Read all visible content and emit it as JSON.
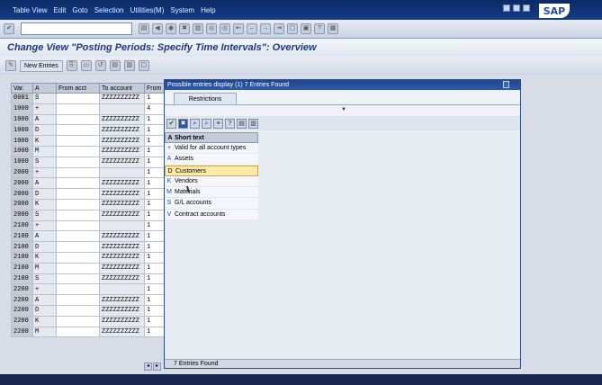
{
  "menu": [
    "Table View",
    "Edit",
    "Goto",
    "Selection",
    "Utilities(M)",
    "System",
    "Help"
  ],
  "brand": "SAP",
  "title": "Change View \"Posting Periods: Specify Time Intervals\": Overview",
  "toolbar2": {
    "new_entries": "New Entries"
  },
  "grid": {
    "headers": [
      "Var.",
      "A",
      "From acct",
      "To account",
      "From"
    ],
    "rows": [
      [
        "0001",
        "S",
        "",
        "ZZZZZZZZZZ",
        "1"
      ],
      [
        "1000",
        "+",
        "",
        "",
        "4"
      ],
      [
        "1000",
        "A",
        "",
        "ZZZZZZZZZZ",
        "1"
      ],
      [
        "1000",
        "D",
        "",
        "ZZZZZZZZZZ",
        "1"
      ],
      [
        "1000",
        "K",
        "",
        "ZZZZZZZZZZ",
        "1"
      ],
      [
        "1000",
        "M",
        "",
        "ZZZZZZZZZZ",
        "1"
      ],
      [
        "1000",
        "S",
        "",
        "ZZZZZZZZZZ",
        "1"
      ],
      [
        "2000",
        "+",
        "",
        "",
        "1"
      ],
      [
        "2000",
        "A",
        "",
        "ZZZZZZZZZZ",
        "1"
      ],
      [
        "2000",
        "D",
        "",
        "ZZZZZZZZZZ",
        "1"
      ],
      [
        "2000",
        "K",
        "",
        "ZZZZZZZZZZ",
        "1"
      ],
      [
        "2000",
        "S",
        "",
        "ZZZZZZZZZZ",
        "1"
      ],
      [
        "2100",
        "+",
        "",
        "",
        "1"
      ],
      [
        "2100",
        "A",
        "",
        "ZZZZZZZZZZ",
        "1"
      ],
      [
        "2100",
        "D",
        "",
        "ZZZZZZZZZZ",
        "1"
      ],
      [
        "2100",
        "K",
        "",
        "ZZZZZZZZZZ",
        "1"
      ],
      [
        "2100",
        "M",
        "",
        "ZZZZZZZZZZ",
        "1"
      ],
      [
        "2100",
        "S",
        "",
        "ZZZZZZZZZZ",
        "1"
      ],
      [
        "2200",
        "+",
        "",
        "",
        "1"
      ],
      [
        "2200",
        "A",
        "",
        "ZZZZZZZZZZ",
        "1"
      ],
      [
        "2200",
        "D",
        "",
        "ZZZZZZZZZZ",
        "1"
      ],
      [
        "2200",
        "K",
        "",
        "ZZZZZZZZZZ",
        "1"
      ],
      [
        "2200",
        "M",
        "",
        "ZZZZZZZZZZ",
        "1"
      ]
    ]
  },
  "popup": {
    "title": "Possible entries display (1)   7 Entries Found",
    "tab": "Restrictions",
    "list_header_key": "A",
    "list_header_text": "Short text",
    "selected_index": 2,
    "entries": [
      {
        "key": "+",
        "text": "Valid for all account types"
      },
      {
        "key": "A",
        "text": "Assets"
      },
      {
        "key": "D",
        "text": "Customers"
      },
      {
        "key": "K",
        "text": "Vendors"
      },
      {
        "key": "M",
        "text": "Materials"
      },
      {
        "key": "S",
        "text": "G/L accounts"
      },
      {
        "key": "V",
        "text": "Contract accounts"
      }
    ],
    "status": "7 Entries Found"
  },
  "colors": {
    "selected_row": "#ffe9a8",
    "title_bar": "#1f468f",
    "key_letter": "#1c4fa0"
  }
}
